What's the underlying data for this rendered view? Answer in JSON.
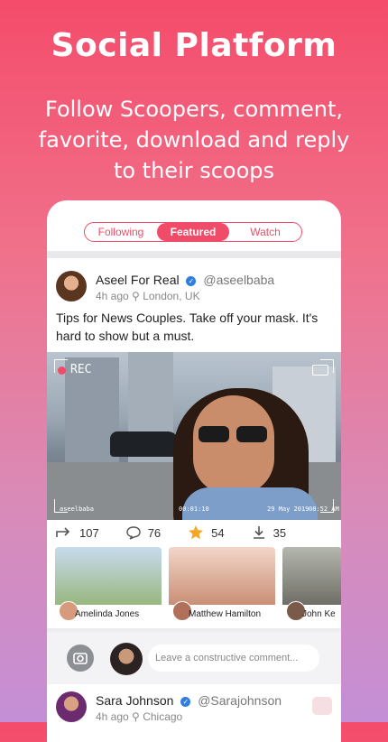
{
  "hero": {
    "title": "Social Platform",
    "subtitle": "Follow Scoopers, comment, favorite, download and reply to their scoops"
  },
  "tabs": [
    {
      "label": "Following",
      "active": false
    },
    {
      "label": "Featured",
      "active": true
    },
    {
      "label": "Watch",
      "active": false
    }
  ],
  "post": {
    "author": "Aseel For Real",
    "handle": "@aseelbaba",
    "time": "4h ago",
    "location": "London, UK",
    "text": "Tips for News Couples. Take off your mask. It's hard to show but a must.",
    "media": {
      "rec_label": "REC",
      "watermark": "aseelbaba",
      "timecode": "00:01:10",
      "date": "29 May 2019",
      "clock": "08:52 AM"
    },
    "actions": [
      {
        "icon": "reply-icon",
        "count": "107"
      },
      {
        "icon": "comment-icon",
        "count": "76"
      },
      {
        "icon": "star-icon",
        "count": "54"
      },
      {
        "icon": "download-icon",
        "count": "35"
      }
    ]
  },
  "related": [
    {
      "name": "Amelinda Jones",
      "bg": "#b9cfe6"
    },
    {
      "name": "Matthew Hamilton",
      "bg": "#e8c7b8"
    },
    {
      "name": "John Ke",
      "bg": "#c9c9c2"
    }
  ],
  "comment": {
    "placeholder": "Leave a constructive comment..."
  },
  "post2": {
    "author": "Sara Johnson",
    "handle": "@Sarajohnson",
    "time": "4h ago",
    "location": "Chicago"
  },
  "colors": {
    "accent": "#f04b68",
    "verified": "#2f7de1",
    "star": "#f5a623"
  }
}
